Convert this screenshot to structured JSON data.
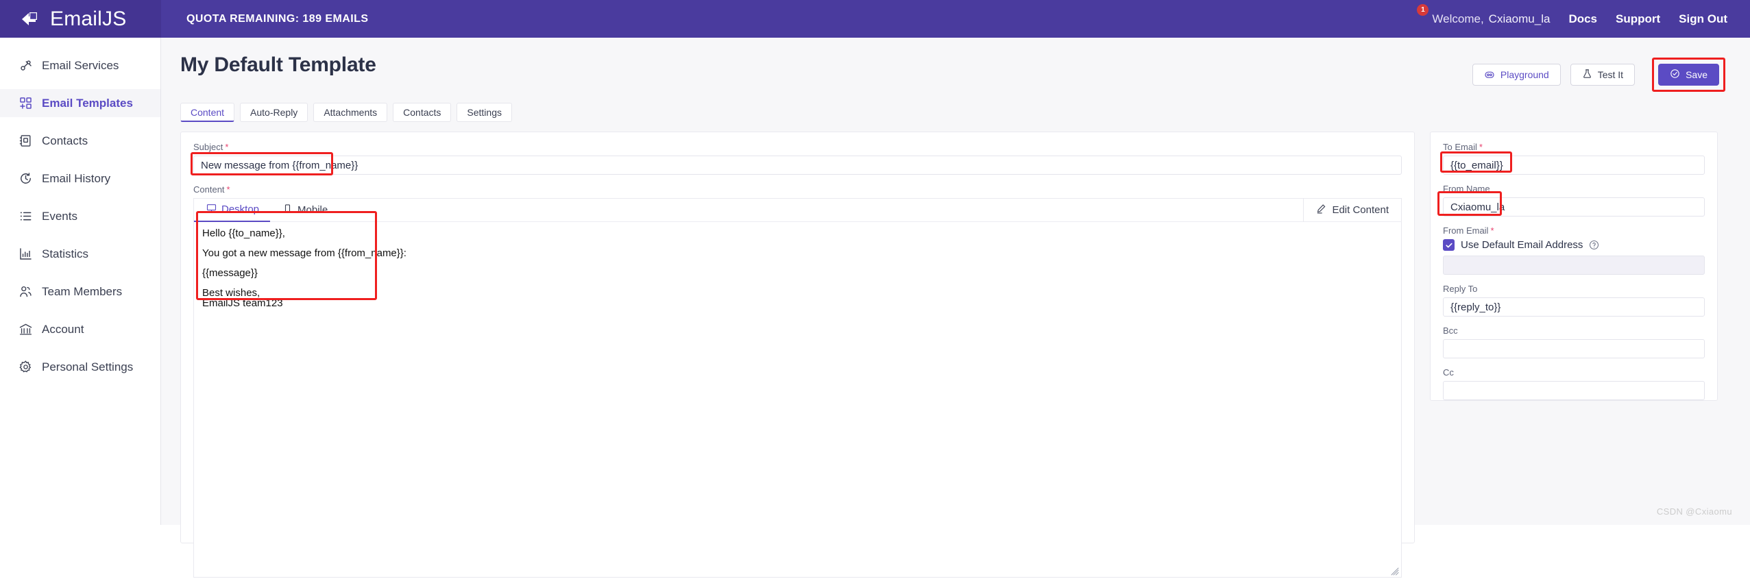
{
  "header": {
    "brand": "EmailJS",
    "quota": "QUOTA REMAINING: 189 EMAILS",
    "notification_count": "1",
    "welcome_label": "Welcome,",
    "username": "Cxiaomu_la",
    "nav": [
      {
        "label": "Docs"
      },
      {
        "label": "Support"
      },
      {
        "label": "Sign Out"
      }
    ]
  },
  "sidebar": {
    "items": [
      {
        "label": "Email Services",
        "icon": "plug-icon",
        "active": false
      },
      {
        "label": "Email Templates",
        "icon": "grid-plus-icon",
        "active": true
      },
      {
        "label": "Contacts",
        "icon": "address-book-icon",
        "active": false
      },
      {
        "label": "Email History",
        "icon": "clock-icon",
        "active": false
      },
      {
        "label": "Events",
        "icon": "list-icon",
        "active": false
      },
      {
        "label": "Statistics",
        "icon": "bar-chart-icon",
        "active": false
      },
      {
        "label": "Team Members",
        "icon": "users-icon",
        "active": false
      },
      {
        "label": "Account",
        "icon": "bank-icon",
        "active": false
      },
      {
        "label": "Personal Settings",
        "icon": "gear-icon",
        "active": false
      }
    ]
  },
  "page": {
    "title": "My Default Template",
    "actions": {
      "playground": "Playground",
      "test_it": "Test It",
      "save": "Save"
    },
    "tabs": [
      {
        "label": "Content",
        "active": true
      },
      {
        "label": "Auto-Reply",
        "active": false
      },
      {
        "label": "Attachments",
        "active": false
      },
      {
        "label": "Contacts",
        "active": false
      },
      {
        "label": "Settings",
        "active": false
      }
    ]
  },
  "content": {
    "subject_label": "Subject",
    "subject_value": "New message from {{from_name}}",
    "content_label": "Content",
    "device_tabs": [
      {
        "label": "Desktop",
        "icon": "desktop-icon",
        "active": true
      },
      {
        "label": "Mobile",
        "icon": "mobile-icon",
        "active": false
      }
    ],
    "edit_content": "Edit Content",
    "body_lines": [
      "Hello {{to_name}},",
      "You got a new message from {{from_name}}:",
      "{{message}}",
      "Best wishes,\nEmailJS team123"
    ]
  },
  "settings_panel": {
    "to_email_label": "To Email",
    "to_email_value": "{{to_email}}",
    "from_name_label": "From Name",
    "from_name_value": "Cxiaomu_la",
    "from_email_label": "From Email",
    "use_default_label": "Use Default Email Address",
    "from_email_value": "",
    "reply_to_label": "Reply To",
    "reply_to_value": "{{reply_to}}",
    "bcc_label": "Bcc",
    "bcc_value": "",
    "cc_label": "Cc",
    "cc_value": ""
  },
  "watermark": "CSDN @Cxiaomu",
  "colors": {
    "brand_purple": "#4a3b9e",
    "brand_purple_dark": "#443492",
    "accent": "#5b4bc4",
    "required_red": "#e8436f",
    "highlight_red": "#ef1f1f",
    "badge_red": "#d73a3a"
  }
}
